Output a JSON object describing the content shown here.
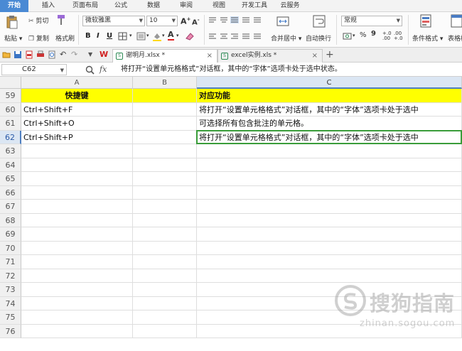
{
  "ribbon_tabs": [
    "开始",
    "插入",
    "页面布局",
    "公式",
    "数据",
    "审阅",
    "视图",
    "开发工具",
    "云服务"
  ],
  "ribbon": {
    "paste": "粘贴",
    "cut": "剪切",
    "copy": "复制",
    "format_painter": "格式刷",
    "font_name": "微软雅黑",
    "font_size": "10",
    "bold": "B",
    "italic": "I",
    "underline": "U",
    "merge_center": "合并居中",
    "wrap_text": "自动换行",
    "number_format": "常规",
    "percent": "%",
    "comma": "9",
    "inc_decimal": "+.0 .00",
    "dec_decimal": ".00 +.0",
    "conditional_format": "条件格式",
    "table_style": "表格样"
  },
  "quick_access": {
    "dropdown_arrow": "▼"
  },
  "doc_tabs": [
    {
      "label": "谢明月.xlsx *",
      "close": "×"
    },
    {
      "label": "excel实例.xls *",
      "close": "×"
    }
  ],
  "new_tab": "+",
  "formula_bar": {
    "cell_ref": "C62",
    "fx": "fx",
    "content": "将打开“设置单元格格式”对话框，其中的“字体”选项卡处于选中状态。"
  },
  "columns": [
    "A",
    "B",
    "C"
  ],
  "rows": [
    {
      "num": "59",
      "a": "快捷键",
      "b": "",
      "c": "对应功能",
      "header": true
    },
    {
      "num": "60",
      "a": "Ctrl+Shift+F",
      "b": "",
      "c": "将打开“设置单元格格式”对话框，其中的“字体”选项卡处于选中"
    },
    {
      "num": "61",
      "a": "Ctrl+Shift+O",
      "b": "",
      "c": "可选择所有包含批注的单元格。"
    },
    {
      "num": "62",
      "a": "Ctrl+Shift+P",
      "b": "",
      "c": "将打开“设置单元格格式”对话框，其中的“字体”选项卡处于选中"
    },
    {
      "num": "63",
      "a": "",
      "b": "",
      "c": ""
    },
    {
      "num": "64",
      "a": "",
      "b": "",
      "c": ""
    },
    {
      "num": "65",
      "a": "",
      "b": "",
      "c": ""
    },
    {
      "num": "66",
      "a": "",
      "b": "",
      "c": ""
    },
    {
      "num": "67",
      "a": "",
      "b": "",
      "c": ""
    },
    {
      "num": "68",
      "a": "",
      "b": "",
      "c": ""
    },
    {
      "num": "69",
      "a": "",
      "b": "",
      "c": ""
    },
    {
      "num": "70",
      "a": "",
      "b": "",
      "c": ""
    },
    {
      "num": "71",
      "a": "",
      "b": "",
      "c": ""
    },
    {
      "num": "72",
      "a": "",
      "b": "",
      "c": ""
    },
    {
      "num": "73",
      "a": "",
      "b": "",
      "c": ""
    },
    {
      "num": "74",
      "a": "",
      "b": "",
      "c": ""
    },
    {
      "num": "75",
      "a": "",
      "b": "",
      "c": ""
    },
    {
      "num": "76",
      "a": "",
      "b": "",
      "c": ""
    }
  ],
  "active_row": "62",
  "active_col": "C",
  "watermark": {
    "text": "搜狗指南",
    "url": "zhinan.sogou.com"
  },
  "colors": {
    "tab_active": "#4a8ad4",
    "header_fill": "#ffff00",
    "active_border": "#3a9d3a",
    "selection_header": "#dbe6f3"
  }
}
